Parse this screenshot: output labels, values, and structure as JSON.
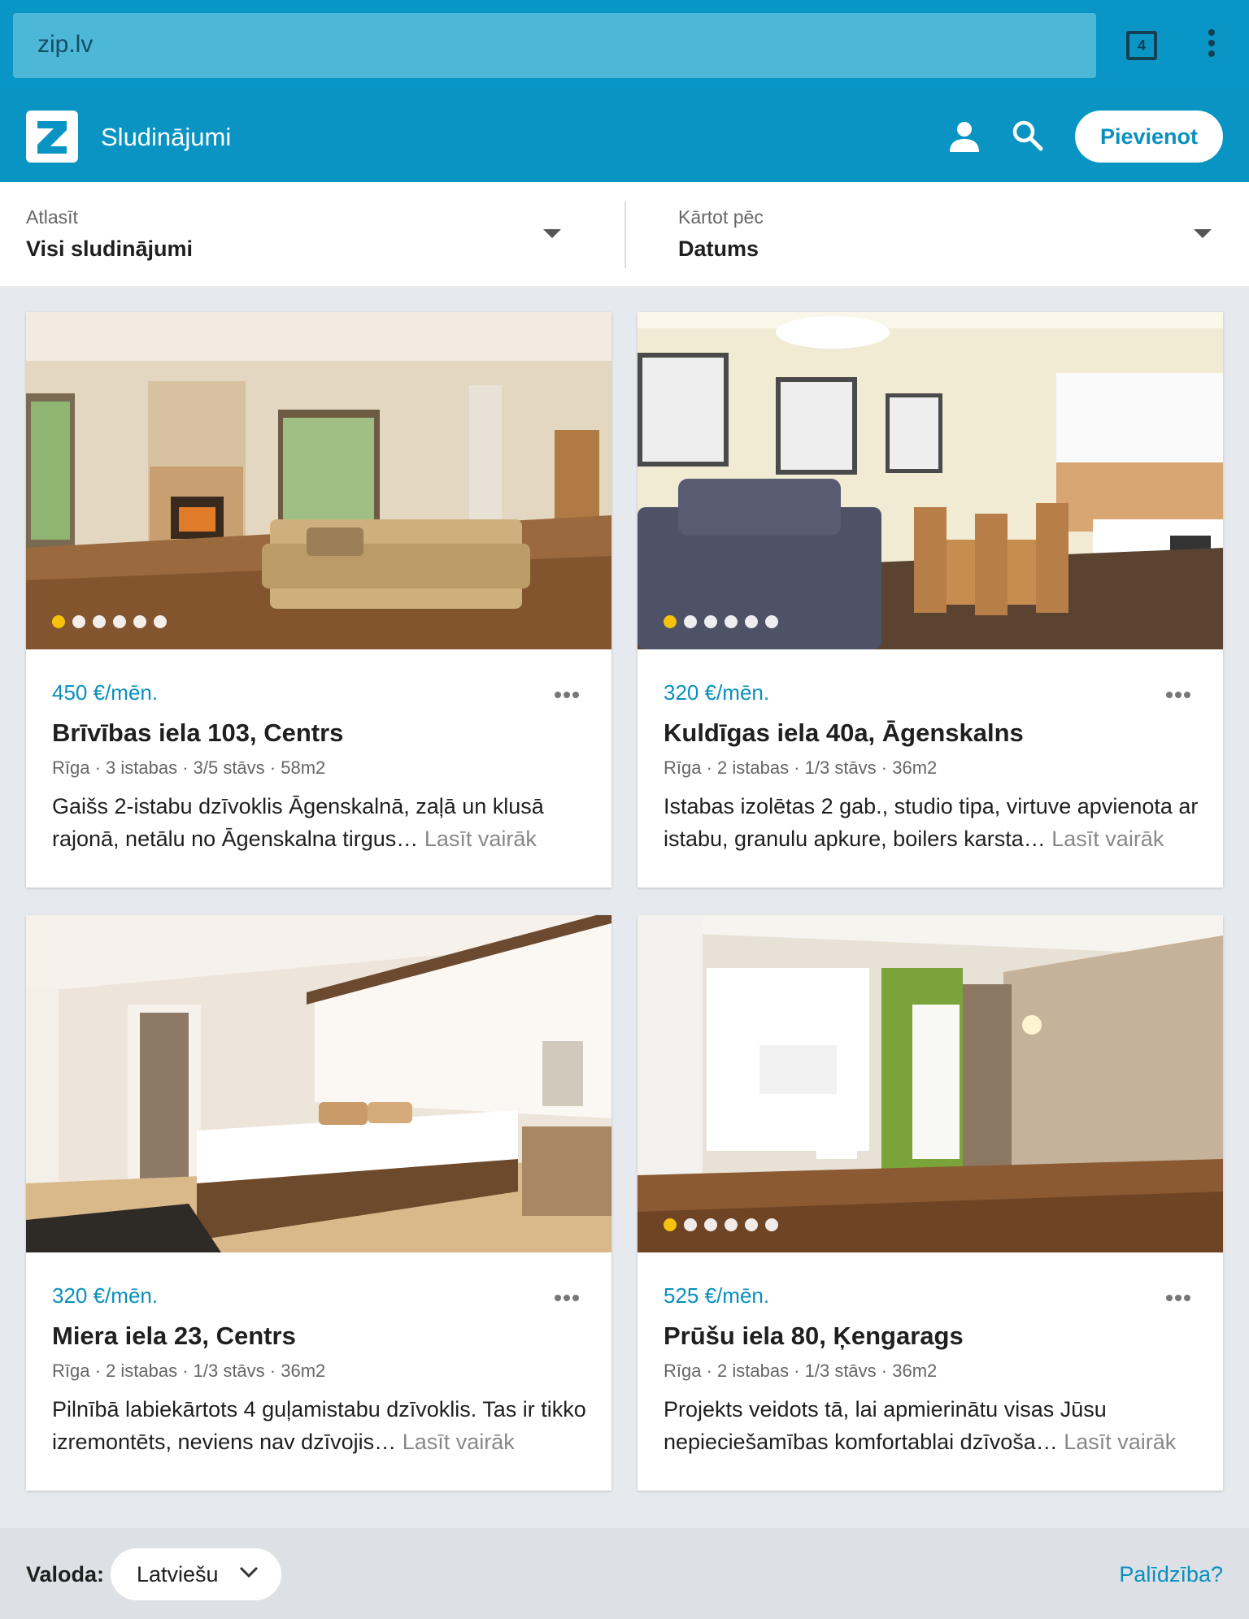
{
  "browser": {
    "url": "zip.lv",
    "tab_count": "4"
  },
  "header": {
    "title": "Sludinājumi",
    "add_button": "Pievienot",
    "user_icon": "user-icon",
    "search_icon": "search-icon"
  },
  "filters": {
    "filter_label": "Atlasīt",
    "filter_value": "Visi sludinājumi",
    "sort_label": "Kārtot pēc",
    "sort_value": "Datums"
  },
  "listings": [
    {
      "price": "450 €/mēn.",
      "title": "Brīvības iela 103, Centrs",
      "meta": "Rīga · 3 istabas · 3/5 stāvs · 58m2",
      "description": "Gaišs 2-istabu dzīvoklis Āgenskalnā, zaļā un klusā rajonā, netālu no Āgenskalna tirgus…",
      "read_more": "Lasīt vairāk",
      "photo_count": 6,
      "active_photo": 1
    },
    {
      "price": "320 €/mēn.",
      "title": "Kuldīgas iela 40a, Āgenskalns",
      "meta": "Rīga · 2 istabas · 1/3 stāvs · 36m2",
      "description": "Istabas izolētas 2 gab., studio tipa, virtuve apvienota ar istabu, granulu apkure, boilers karsta…",
      "read_more": "Lasīt vairāk",
      "photo_count": 6,
      "active_photo": 1
    },
    {
      "price": "320 €/mēn.",
      "title": "Miera iela 23, Centrs",
      "meta": "Rīga · 2 istabas · 1/3 stāvs · 36m2",
      "description": "Pilnībā labiekārtots 4 guļamistabu dzīvoklis. Tas ir tikko izremontēts, neviens nav dzīvojis…",
      "read_more": "Lasīt vairāk",
      "photo_count": 0,
      "active_photo": 0
    },
    {
      "price": "525 €/mēn.",
      "title": "Prūšu iela 80, Ķengarags",
      "meta": "Rīga · 2 istabas · 1/3 stāvs · 36m2",
      "description": "Projekts veidots tā, lai apmierinātu visas Jūsu nepieciešamības komfortablai dzīvoša…",
      "read_more": "Lasīt vairāk",
      "photo_count": 6,
      "active_photo": 1
    }
  ],
  "footer": {
    "language_label": "Valoda:",
    "language_value": "Latviešu",
    "help_link": "Palīdzība?"
  },
  "colors": {
    "brand": "#0a94c4",
    "browser_bar": "#0996c6",
    "price": "#0a8fbe",
    "active_dot": "#f6c20b"
  }
}
